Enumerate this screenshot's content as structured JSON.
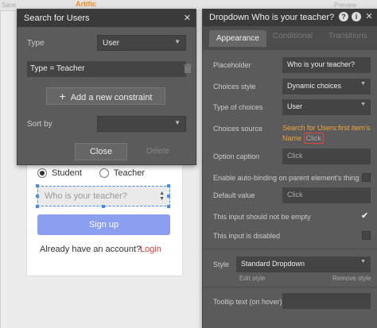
{
  "background": {
    "left_fragment": "Save",
    "orange_fragment": "Artific",
    "right_fragment": "Preview",
    "page": {
      "radio_student": "Student",
      "radio_teacher": "Teacher",
      "dropdown_placeholder": "Who is your teacher?",
      "signup_label": "Sign up",
      "already_text": "Already have an account?",
      "login_label": "Login"
    }
  },
  "search_panel": {
    "title": "Search for Users",
    "type_label": "Type",
    "type_value": "User",
    "constraint_text": "Type =  Teacher",
    "add_constraint_label": "Add a new constraint",
    "sort_label": "Sort by",
    "sort_value": "",
    "close_label": "Close",
    "delete_label": "Delete"
  },
  "prop_panel": {
    "title": "Dropdown Who is your teacher?",
    "tabs": [
      "Appearance",
      "Conditional",
      "Transitions"
    ],
    "placeholder_label": "Placeholder",
    "placeholder_value": "Who is your teacher?",
    "choices_style_label": "Choices style",
    "choices_style_value": "Dynamic choices",
    "type_of_choices_label": "Type of choices",
    "type_of_choices_value": "User",
    "choices_source_label": "Choices source",
    "choices_source_expr": "Search for Users:first item's Name",
    "choices_source_click": "Click",
    "option_caption_label": "Option caption",
    "option_caption_value": "Click",
    "autobinding_label": "Enable auto-binding on parent element's thing",
    "default_value_label": "Default value",
    "default_value_value": "Click",
    "not_empty_label": "This input should not be empty",
    "disabled_label": "This input is disabled",
    "style_label": "Style",
    "style_value": "Standard Dropdown",
    "edit_style_label": "Edit style",
    "remove_style_label": "Remove style",
    "tooltip_label": "Tooltip text (on hover)",
    "checkboxes": {
      "autobinding": false,
      "not_empty": true,
      "disabled": false
    }
  },
  "colors": {
    "panel_bg": "#5b5b5b",
    "panel_header": "#3a3a3a",
    "expression_orange": "#f2a33a",
    "signup_button": "#8c9ef0",
    "login_red": "#e03a3a"
  }
}
